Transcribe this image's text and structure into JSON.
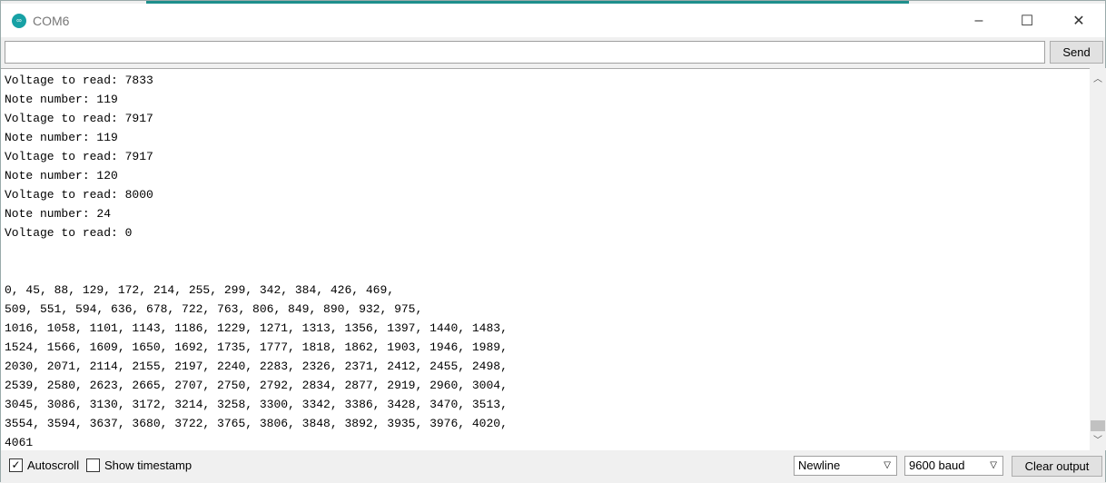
{
  "window": {
    "title": "COM6",
    "minimize": "–",
    "maximize": "☐",
    "close": "✕"
  },
  "input": {
    "value": "",
    "send_label": "Send"
  },
  "output_lines": [
    "Voltage to read: 7833",
    "Note number: 119",
    "Voltage to read: 7917",
    "Note number: 119",
    "Voltage to read: 7917",
    "Note number: 120",
    "Voltage to read: 8000",
    "Note number: 24",
    "Voltage to read: 0",
    "",
    "",
    "0, 45, 88, 129, 172, 214, 255, 299, 342, 384, 426, 469,",
    "509, 551, 594, 636, 678, 722, 763, 806, 849, 890, 932, 975,",
    "1016, 1058, 1101, 1143, 1186, 1229, 1271, 1313, 1356, 1397, 1440, 1483,",
    "1524, 1566, 1609, 1650, 1692, 1735, 1777, 1818, 1862, 1903, 1946, 1989,",
    "2030, 2071, 2114, 2155, 2197, 2240, 2283, 2326, 2371, 2412, 2455, 2498,",
    "2539, 2580, 2623, 2665, 2707, 2750, 2792, 2834, 2877, 2919, 2960, 3004,",
    "3045, 3086, 3130, 3172, 3214, 3258, 3300, 3342, 3386, 3428, 3470, 3513,",
    "3554, 3594, 3637, 3680, 3722, 3765, 3806, 3848, 3892, 3935, 3976, 4020,",
    "4061"
  ],
  "footer": {
    "autoscroll": "Autoscroll",
    "autoscroll_checked": true,
    "timestamp": "Show timestamp",
    "timestamp_checked": false,
    "line_ending": "Newline",
    "baud": "9600 baud",
    "clear_label": "Clear output"
  }
}
